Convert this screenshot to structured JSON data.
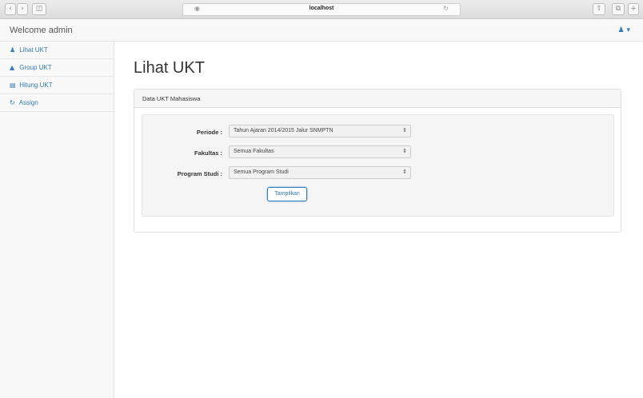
{
  "browser": {
    "url": "localhost",
    "back_icon": "chevron-left-icon",
    "forward_icon": "chevron-right-icon"
  },
  "header": {
    "welcome": "Welcome admin",
    "user_icon": "user-icon"
  },
  "sidebar": {
    "items": [
      {
        "label": "Lihat UKT",
        "icon": "users-icon"
      },
      {
        "label": "Group UKT",
        "icon": "sitemap-icon"
      },
      {
        "label": "Hitung UKT",
        "icon": "bar-chart-icon"
      },
      {
        "label": "Assign",
        "icon": "refresh-icon"
      }
    ]
  },
  "main": {
    "title": "Lihat UKT",
    "panel_title": "Data UKT Mahasiswa",
    "form": {
      "periode_label": "Periode :",
      "periode_value": "Tahun Ajaran 2014/2015 Jalur SNMPTN",
      "fakultas_label": "Fakultas :",
      "fakultas_value": "Semua Fakultas",
      "prodi_label": "Program Studi :",
      "prodi_value": "Semua Program Studi",
      "submit_label": "Tampilkan"
    }
  },
  "colors": {
    "accent": "#337ab7",
    "panel_bg": "#f5f5f5"
  }
}
